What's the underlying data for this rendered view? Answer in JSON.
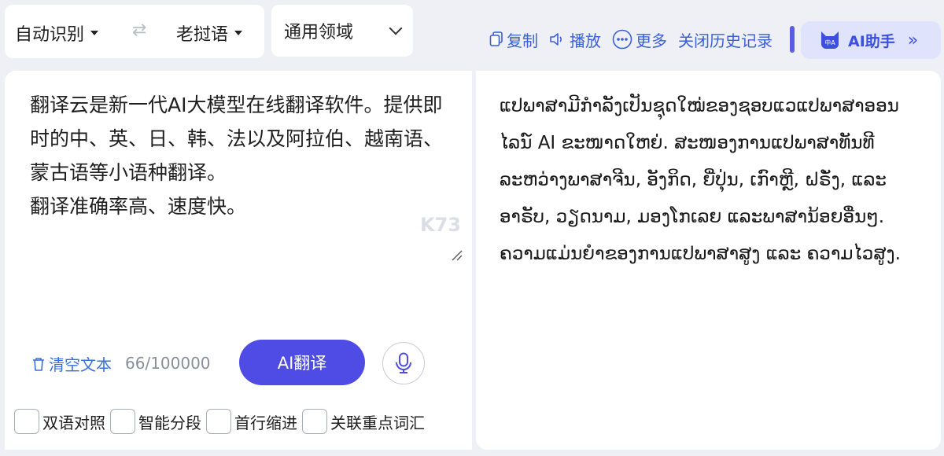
{
  "lang_bar": {
    "source_lang": "自动识别",
    "swap_icon": "⇄",
    "target_lang": "老挝语"
  },
  "domain_select": {
    "value": "通用领域"
  },
  "toolbar": {
    "copy": "复制",
    "play": "播放",
    "more": "更多",
    "close_history": "关闭历史记录"
  },
  "ai_assistant": {
    "avatar_text": "中A",
    "label": "AI助手",
    "chevrons": "»"
  },
  "source": {
    "text": "翻译云是新一代AI大模型在线翻译软件。提供即时的中、英、日、韩、法以及阿拉伯、越南语、蒙古语等小语种翻译。\n翻译准确率高、速度快。",
    "clear_label": "清空文本",
    "counter": "66/100000",
    "translate_label": "AI翻译"
  },
  "options": [
    {
      "label": "双语对照",
      "checked": false
    },
    {
      "label": "智能分段",
      "checked": false
    },
    {
      "label": "首行缩进",
      "checked": false
    },
    {
      "label": "关联重点词汇",
      "checked": false
    }
  ],
  "target": {
    "text": "ແປພາສາມີກຳລັງເປັນຊຸດໃໝ່ຂອງຊອບແວແປພາສາອອນໄລນ໌ AI ຂະໜາດໃຫຍ່. ສະໜອງການແປພາສາທັນທີລະຫວ່າງພາສາຈີນ, ອັງກິດ, ຍີ່ປຸ່ນ, ເກົາຫຼີ, ຝຣັ່ງ, ແລະອາຣັບ, ວຽດນາມ, ມອງໂກເລຍ ແລະພາສານ້ອຍອື່ນໆ. ຄວາມແມ່ນຍໍາຂອງການແປພາສາສູງ ແລະ ຄວາມໄວສູງ."
  },
  "watermark": "K73",
  "colors": {
    "accent": "#4f4ce6",
    "link": "#3a5fd9",
    "background": "#eef0f6"
  }
}
